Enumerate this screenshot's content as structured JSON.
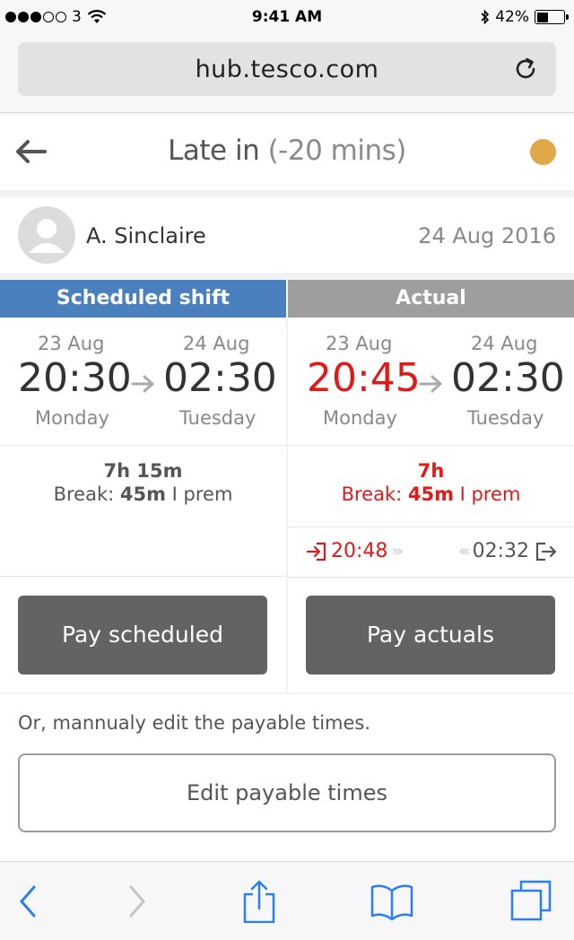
{
  "status_bar": {
    "carrier": "3",
    "time": "9:41 AM",
    "battery": "42%",
    "battery_level": 0.42
  },
  "browser": {
    "url": "hub.tesco.com"
  },
  "header": {
    "title": "Late in",
    "subtitle": "(-20 mins)",
    "status_color": "#e0a948"
  },
  "person": {
    "name": "A. Sinclaire",
    "date": "24 Aug 2016"
  },
  "scheduled": {
    "heading": "Scheduled shift",
    "start": {
      "date": "23 Aug",
      "time": "20:30",
      "day": "Monday"
    },
    "end": {
      "date": "24 Aug",
      "time": "02:30",
      "day": "Tuesday"
    },
    "duration": "7h 15m",
    "break_prefix": "Break:",
    "break_value": "45m",
    "break_suffix": "I prem",
    "button": "Pay scheduled"
  },
  "actual": {
    "heading": "Actual",
    "start": {
      "date": "23 Aug",
      "time": "20:45",
      "day": "Monday"
    },
    "end": {
      "date": "24 Aug",
      "time": "02:30",
      "day": "Tuesday"
    },
    "duration": "7h",
    "break_prefix": "Break:",
    "break_value": "45m",
    "break_suffix": "I prem",
    "clock_in": "20:48",
    "clock_out": "02:32",
    "button": "Pay actuals"
  },
  "manual": {
    "hint": "Or, mannualy edit the payable times.",
    "button": "Edit payable times"
  },
  "colors": {
    "scheduled_header": "#4a80bd",
    "actual_header": "#9e9e9e",
    "late": "#e11919",
    "ios_blue": "#2a7ff5"
  }
}
